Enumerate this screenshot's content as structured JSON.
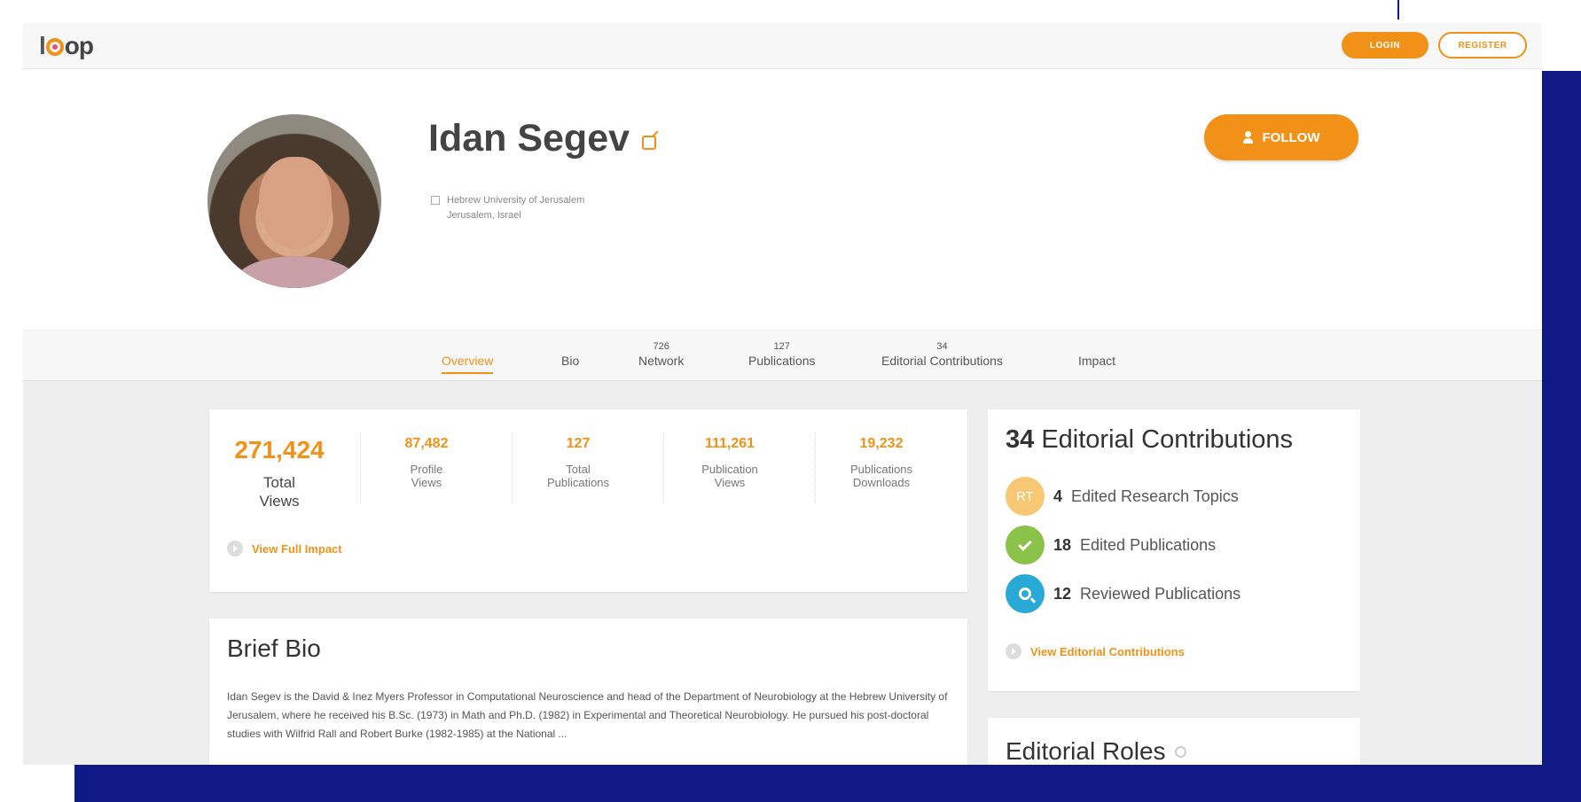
{
  "brand": {
    "logo_left": "l",
    "logo_right": "op"
  },
  "nav": {
    "login": "LOGIN",
    "register": "REGISTER"
  },
  "profile": {
    "name": "Idan Segev",
    "institution": "Hebrew University of Jerusalem",
    "location": "Jerusalem, Israel",
    "follow_label": "FOLLOW"
  },
  "tabs": [
    {
      "count": "",
      "label": "Overview",
      "active": true
    },
    {
      "count": "",
      "label": "Bio"
    },
    {
      "count": "726",
      "label": "Network"
    },
    {
      "count": "127",
      "label": "Publications"
    },
    {
      "count": "34",
      "label": "Editorial Contributions"
    },
    {
      "count": "",
      "label": "Impact"
    }
  ],
  "stats": {
    "total_views": {
      "value": "271,424",
      "label_1": "Total",
      "label_2": "Views"
    },
    "profile_views": {
      "value": "87,482",
      "label_1": "Profile",
      "label_2": "Views"
    },
    "total_publications": {
      "value": "127",
      "label_1": "Total",
      "label_2": "Publications"
    },
    "publication_views": {
      "value": "111,261",
      "label_1": "Publication",
      "label_2": "Views"
    },
    "publication_downloads": {
      "value": "19,232",
      "label_1": "Publications",
      "label_2": "Downloads"
    },
    "view_full_impact": "View Full Impact"
  },
  "bio": {
    "title": "Brief Bio",
    "text": "Idan Segev is the David & Inez Myers Professor in Computational Neuroscience and head of the Department of Neurobiology at the Hebrew University of Jerusalem, where he received his B.Sc. (1973) in Math and Ph.D. (1982) in Experimental and Theoretical Neurobiology. He pursued his post-doctoral studies with Wilfrid Rall and Robert Burke (1982-1985) at the National ..."
  },
  "editorial": {
    "count": "34",
    "title": "Editorial Contributions",
    "rows": [
      {
        "badge": "RT",
        "count": "4",
        "label": "Edited Research Topics"
      },
      {
        "count": "18",
        "label": "Edited Publications"
      },
      {
        "count": "12",
        "label": "Reviewed Publications"
      }
    ],
    "view_link": "View Editorial Contributions"
  },
  "roles": {
    "title": "Editorial Roles"
  },
  "colors": {
    "accent": "#f29118",
    "frame": "#0f1a86",
    "badge_rt": "#f7c873",
    "badge_ep": "#8bc34a",
    "badge_rp": "#29a9d6"
  }
}
